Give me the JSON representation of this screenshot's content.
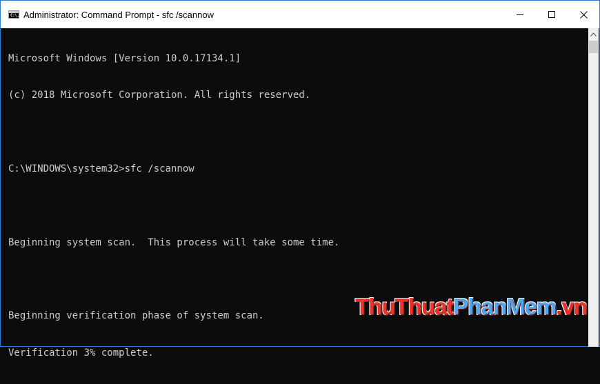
{
  "window": {
    "title": "Administrator: Command Prompt - sfc  /scannow",
    "icon": "cmd-icon",
    "icon_glyph": "C:\\.",
    "controls": [
      "minimize",
      "maximize",
      "close"
    ],
    "border_color": "#2b7bd6"
  },
  "console": {
    "text_color": "#cccccc",
    "background": "#0c0c0c",
    "lines": [
      "Microsoft Windows [Version 10.0.17134.1]",
      "(c) 2018 Microsoft Corporation. All rights reserved.",
      "",
      "C:\\WINDOWS\\system32>sfc /scannow",
      "",
      "Beginning system scan.  This process will take some time.",
      "",
      "Beginning verification phase of system scan.",
      "Verification 3% complete."
    ]
  },
  "watermark": {
    "part1": "ThuThuat",
    "part2": "PhanMem",
    "part3": ".vn",
    "colors": {
      "part1": "#e7352b",
      "part2": "#4fa6ee",
      "part3": "#e7352b"
    }
  }
}
